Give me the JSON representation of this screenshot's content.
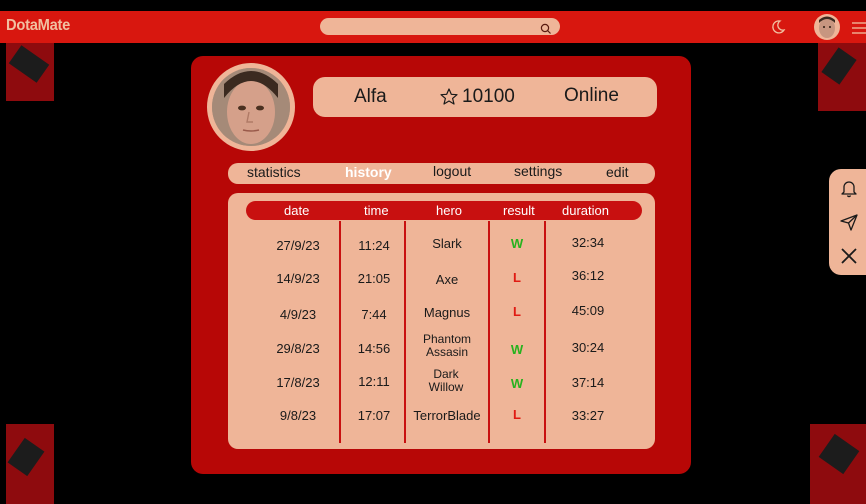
{
  "app": {
    "logo": "DotaMate"
  },
  "search": {
    "value": "",
    "placeholder": ""
  },
  "profile": {
    "name": "Alfa",
    "rating": "10100",
    "status": "Online"
  },
  "tabs": [
    {
      "label": "statistics",
      "active": false
    },
    {
      "label": "history",
      "active": true
    },
    {
      "label": "logout",
      "active": false
    },
    {
      "label": "settings",
      "active": false
    },
    {
      "label": "edit",
      "active": false
    }
  ],
  "history": {
    "columns": [
      "date",
      "time",
      "hero",
      "result",
      "duration"
    ],
    "rows": [
      {
        "date": "27/9/23",
        "time": "11:24",
        "hero": "Slark",
        "result": "W",
        "duration": "32:34"
      },
      {
        "date": "14/9/23",
        "time": "21:05",
        "hero": "Axe",
        "result": "L",
        "duration": "36:12"
      },
      {
        "date": "4/9/23",
        "time": "7:44",
        "hero": "Magnus",
        "result": "L",
        "duration": "45:09"
      },
      {
        "date": "29/8/23",
        "time": "14:56",
        "hero": "Phantom Assasin",
        "result": "W",
        "duration": "30:24"
      },
      {
        "date": "17/8/23",
        "time": "12:11",
        "hero": "Dark Willow",
        "result": "W",
        "duration": "37:14"
      },
      {
        "date": "9/8/23",
        "time": "17:07",
        "hero": "TerrorBlade",
        "result": "L",
        "duration": "33:27"
      }
    ]
  },
  "colors": {
    "accent": "#d8170f",
    "card": "#b70706",
    "panel": "#efb598",
    "win": "#27b21e",
    "loss": "#e01a12"
  },
  "icons": {
    "search": "search-icon",
    "theme": "moon-icon",
    "menu": "menu-icon",
    "star": "star-icon",
    "notifications": "bell-icon",
    "send": "send-icon",
    "close": "close-icon"
  }
}
